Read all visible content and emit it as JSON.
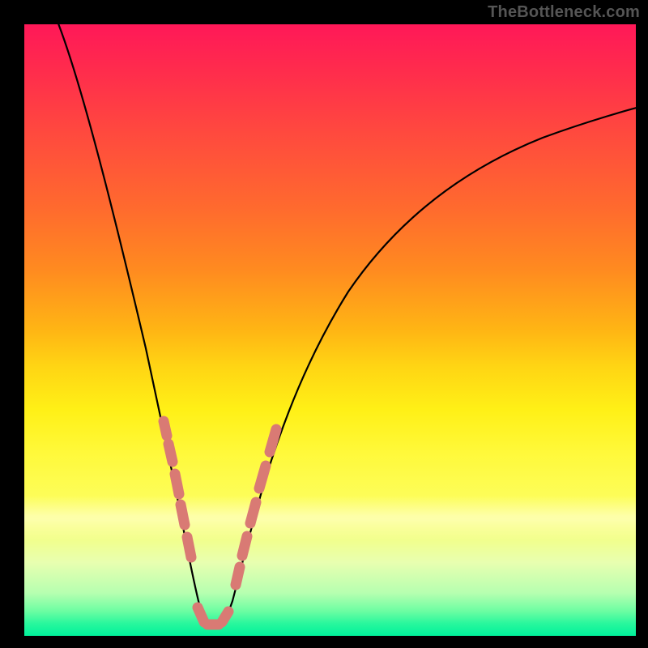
{
  "watermark": "TheBottleneck.com",
  "colors": {
    "page_bg": "#000000",
    "gradient_top": "#ff1858",
    "gradient_mid": "#fff016",
    "gradient_bottom": "#00f19a",
    "curve": "#000000",
    "clumps": "#d97a74",
    "watermark_text": "#555555"
  },
  "chart_data": {
    "type": "line",
    "title": "",
    "xlabel": "",
    "ylabel": "",
    "x_range": [
      0,
      100
    ],
    "y_range": [
      0,
      100
    ],
    "series": [
      {
        "name": "v-curve",
        "x": [
          6,
          10,
          14,
          17,
          20,
          22,
          24,
          25,
          26,
          27,
          28,
          29,
          30,
          31,
          32,
          33,
          34,
          36,
          38,
          42,
          48,
          56,
          66,
          78,
          90,
          100
        ],
        "y": [
          100,
          85,
          70,
          56,
          42,
          32,
          22,
          16,
          10,
          6,
          3,
          2,
          2,
          3,
          6,
          10,
          16,
          25,
          36,
          50,
          62,
          72,
          78,
          83,
          86,
          88
        ]
      }
    ],
    "clumps": [
      {
        "name": "left-arm-clump",
        "x_range": [
          21.5,
          25.5
        ],
        "y_range": [
          12,
          36
        ]
      },
      {
        "name": "valley-clump",
        "x_range": [
          27.0,
          31.5
        ],
        "y_range": [
          2,
          4
        ]
      },
      {
        "name": "right-arm-clump",
        "x_range": [
          33.0,
          38.0
        ],
        "y_range": [
          12,
          36
        ]
      }
    ],
    "notes": "V-shaped curve on a vertical rainbow-like gradient; minimum bottleneck near x≈29–30 at y≈2. Salmon-colored clustered markers on both arms near the bottom and along the valley floor."
  }
}
